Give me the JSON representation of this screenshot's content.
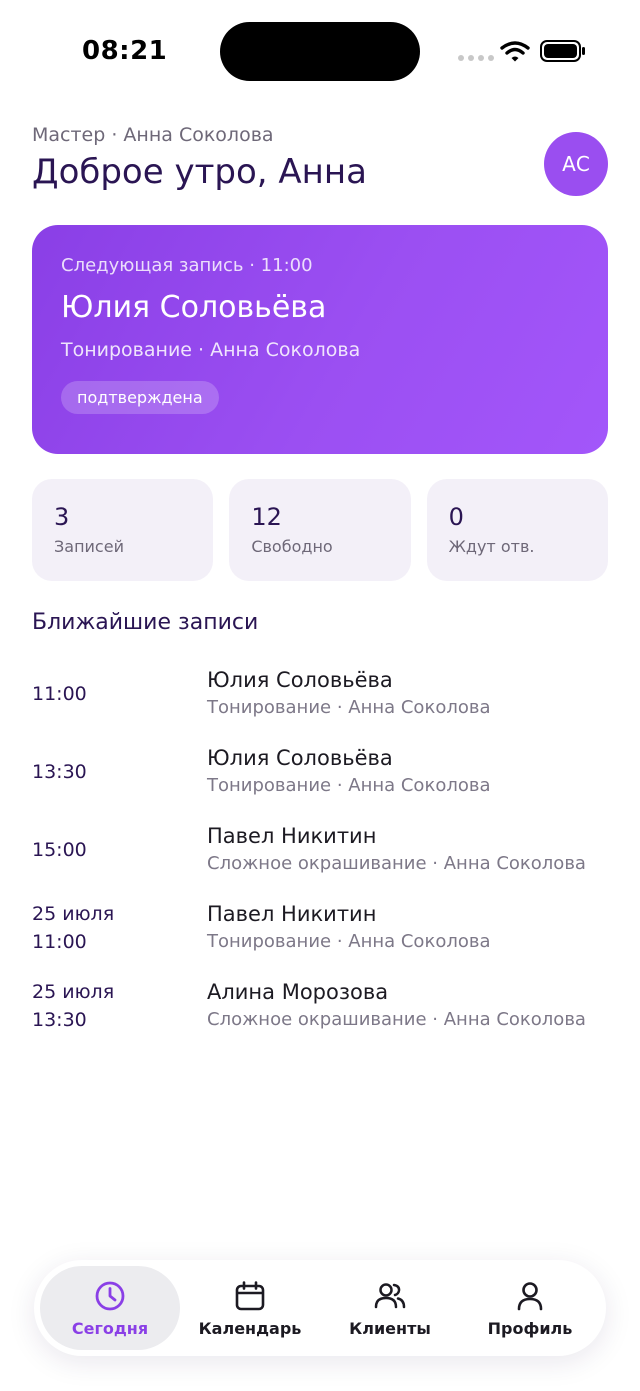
{
  "status_bar": {
    "time": "08:21"
  },
  "header": {
    "subtitle": "Мастер · Анна Соколова",
    "greeting": "Доброе утро, Анна",
    "avatar_initials": "АС"
  },
  "next_appointment": {
    "label": "Следующая запись · 11:00",
    "client": "Юлия Соловьёва",
    "service": "Тонирование · Анна Соколова",
    "status": "подтверждена"
  },
  "stats": [
    {
      "value": "3",
      "label": "Записей"
    },
    {
      "value": "12",
      "label": "Свободно"
    },
    {
      "value": "0",
      "label": "Ждут отв."
    }
  ],
  "upcoming": {
    "title": "Ближайшие записи",
    "items": [
      {
        "date": "",
        "time": "11:00",
        "client": "Юлия Соловьёва",
        "service": "Тонирование · Анна Соколова"
      },
      {
        "date": "",
        "time": "13:30",
        "client": "Юлия Соловьёва",
        "service": "Тонирование · Анна Соколова"
      },
      {
        "date": "",
        "time": "15:00",
        "client": "Павел Никитин",
        "service": "Сложное окрашивание · Анна Соколова"
      },
      {
        "date": "25 июля",
        "time": "11:00",
        "client": "Павел Никитин",
        "service": "Тонирование · Анна Соколова"
      },
      {
        "date": "25 июля",
        "time": "13:30",
        "client": "Алина Морозова",
        "service": "Сложное окрашивание · Анна Соколова"
      }
    ]
  },
  "tabs": [
    {
      "label": "Сегодня",
      "icon": "clock-icon",
      "active": true
    },
    {
      "label": "Календарь",
      "icon": "calendar-icon",
      "active": false
    },
    {
      "label": "Клиенты",
      "icon": "users-icon",
      "active": false
    },
    {
      "label": "Профиль",
      "icon": "user-icon",
      "active": false
    }
  ],
  "colors": {
    "accent": "#8a3fe6",
    "text_dark": "#2a1553",
    "muted": "#6e6878",
    "stat_bg": "#f3f0f8"
  }
}
